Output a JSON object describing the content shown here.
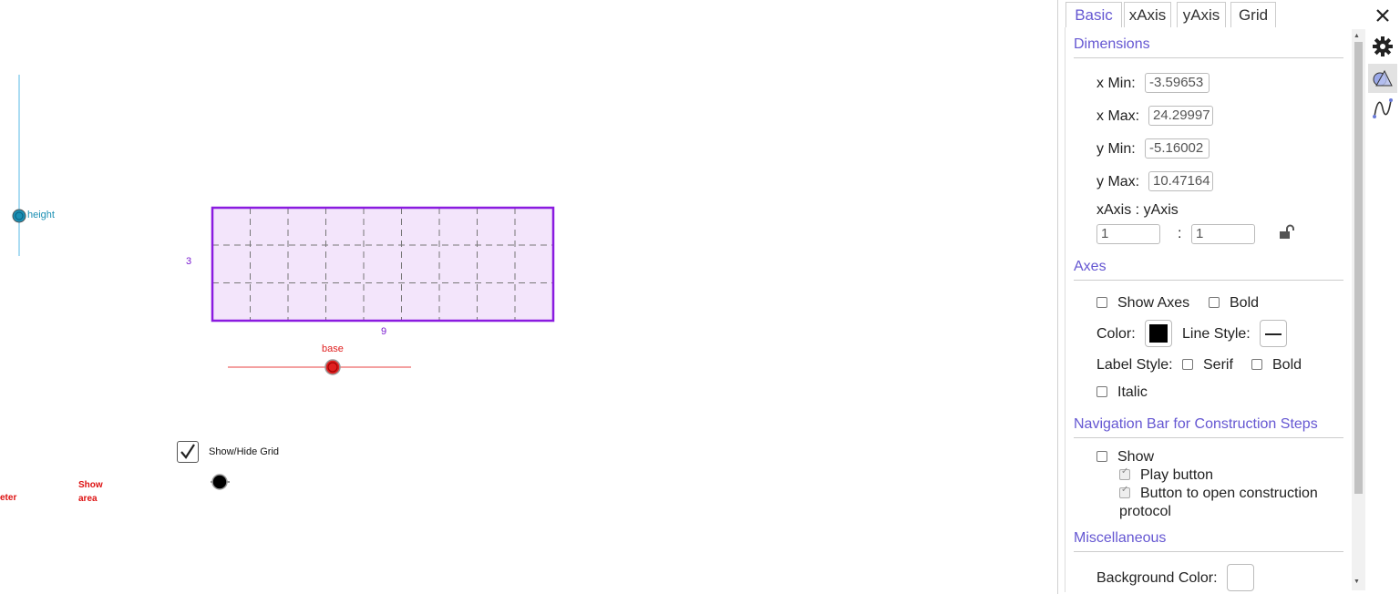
{
  "canvas": {
    "sliders": {
      "height": {
        "label": "height"
      },
      "base": {
        "label": "base"
      }
    },
    "rectangle": {
      "side_label": "3",
      "bottom_label": "9",
      "fill": "#f3e5fb",
      "stroke": "#8a1be0"
    },
    "checkbox": {
      "label": "Show/Hide Grid",
      "checked": true
    },
    "text_perimeter": "eter",
    "text_show": "Show",
    "text_area": "area",
    "accent_red": "#d11",
    "accent_teal": "#1a8fb3"
  },
  "panel": {
    "tabs": [
      {
        "label": "Basic",
        "active": true
      },
      {
        "label": "xAxis",
        "active": false
      },
      {
        "label": "yAxis",
        "active": false
      },
      {
        "label": "Grid",
        "active": false
      }
    ],
    "icons": [
      "close-icon",
      "gear-icon",
      "graphics-view-icon",
      "algebra-curve-icon"
    ],
    "dimensions": {
      "title": "Dimensions",
      "xmin_label": "x Min:",
      "xmin": "-3.59653",
      "xmax_label": "x Max:",
      "xmax": "24.29997",
      "ymin_label": "y Min:",
      "ymin": "-5.16002",
      "ymax_label": "y Max:",
      "ymax": "10.47164",
      "ratio_label": "xAxis : yAxis",
      "ratio_x": "1",
      "ratio_sep": ":",
      "ratio_y": "1"
    },
    "axes": {
      "title": "Axes",
      "show_axes": "Show Axes",
      "bold": "Bold",
      "color_label": "Color:",
      "color": "#000000",
      "line_style_label": "Line Style:",
      "label_style": "Label Style:",
      "serif": "Serif",
      "bold2": "Bold",
      "italic": "Italic"
    },
    "navigation": {
      "title": "Navigation Bar for Construction Steps",
      "show": "Show",
      "play_button": "Play button",
      "open_protocol_1": "Button to open construction",
      "open_protocol_2": "protocol"
    },
    "misc": {
      "title": "Miscellaneous",
      "background_color": "Background Color:"
    }
  }
}
